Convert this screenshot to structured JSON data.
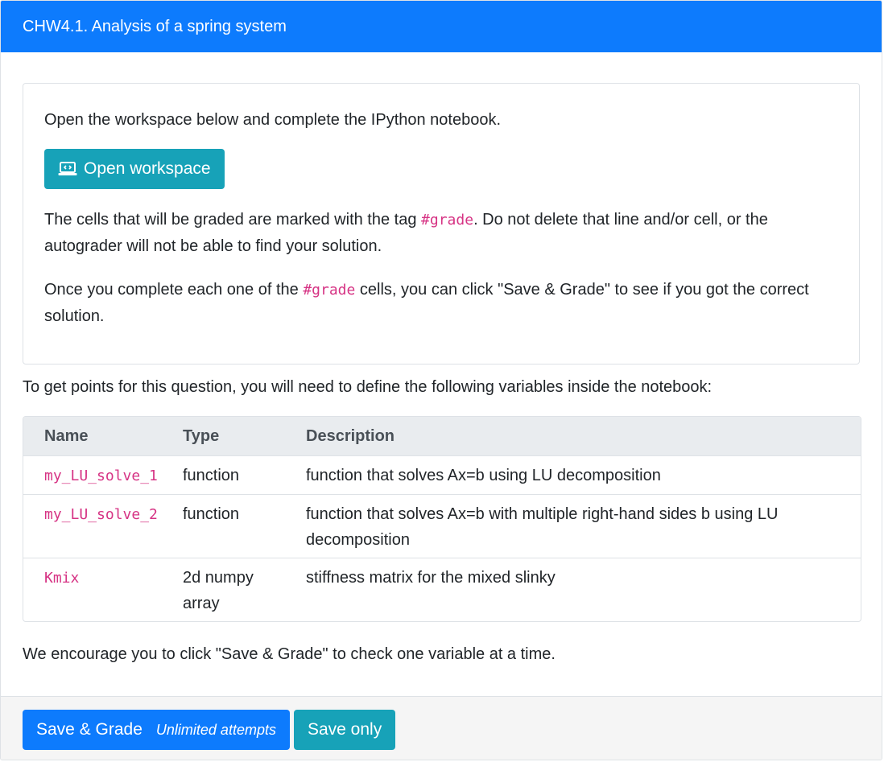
{
  "header": {
    "title": "CHW4.1. Analysis of a spring system"
  },
  "instructions": {
    "open_text": "Open the workspace below and complete the IPython notebook.",
    "open_button_label": "Open workspace",
    "open_button_icon": "laptop-code-icon",
    "para2_before": "The cells that will be graded are marked with the tag ",
    "para2_code": "#grade",
    "para2_after": ". Do not delete that line and/or cell, or the autograder will not be able to find your solution.",
    "para3_before": "Once you complete each one of the ",
    "para3_code": "#grade",
    "para3_after": " cells, you can click \"Save & Grade\" to see if you got the correct solution."
  },
  "intro_text": "To get points for this question, you will need to define the following variables inside the notebook:",
  "table": {
    "headers": [
      "Name",
      "Type",
      "Description"
    ],
    "rows": [
      {
        "name": "my_LU_solve_1",
        "type": "function",
        "description": "function that solves Ax=b using LU decomposition"
      },
      {
        "name": "my_LU_solve_2",
        "type": "function",
        "description": "function that solves Ax=b with multiple right-hand sides b using LU decomposition"
      },
      {
        "name": "Kmix",
        "type": "2d numpy array",
        "description": "stiffness matrix for the mixed slinky"
      }
    ]
  },
  "outro_text": "We encourage you to click \"Save & Grade\" to check one variable at a time.",
  "footer": {
    "save_grade_label": "Save & Grade",
    "attempts_label": "Unlimited attempts",
    "save_only_label": "Save only"
  },
  "colors": {
    "primary": "#0d7bfd",
    "info": "#17a2b8",
    "code": "#d63384"
  }
}
